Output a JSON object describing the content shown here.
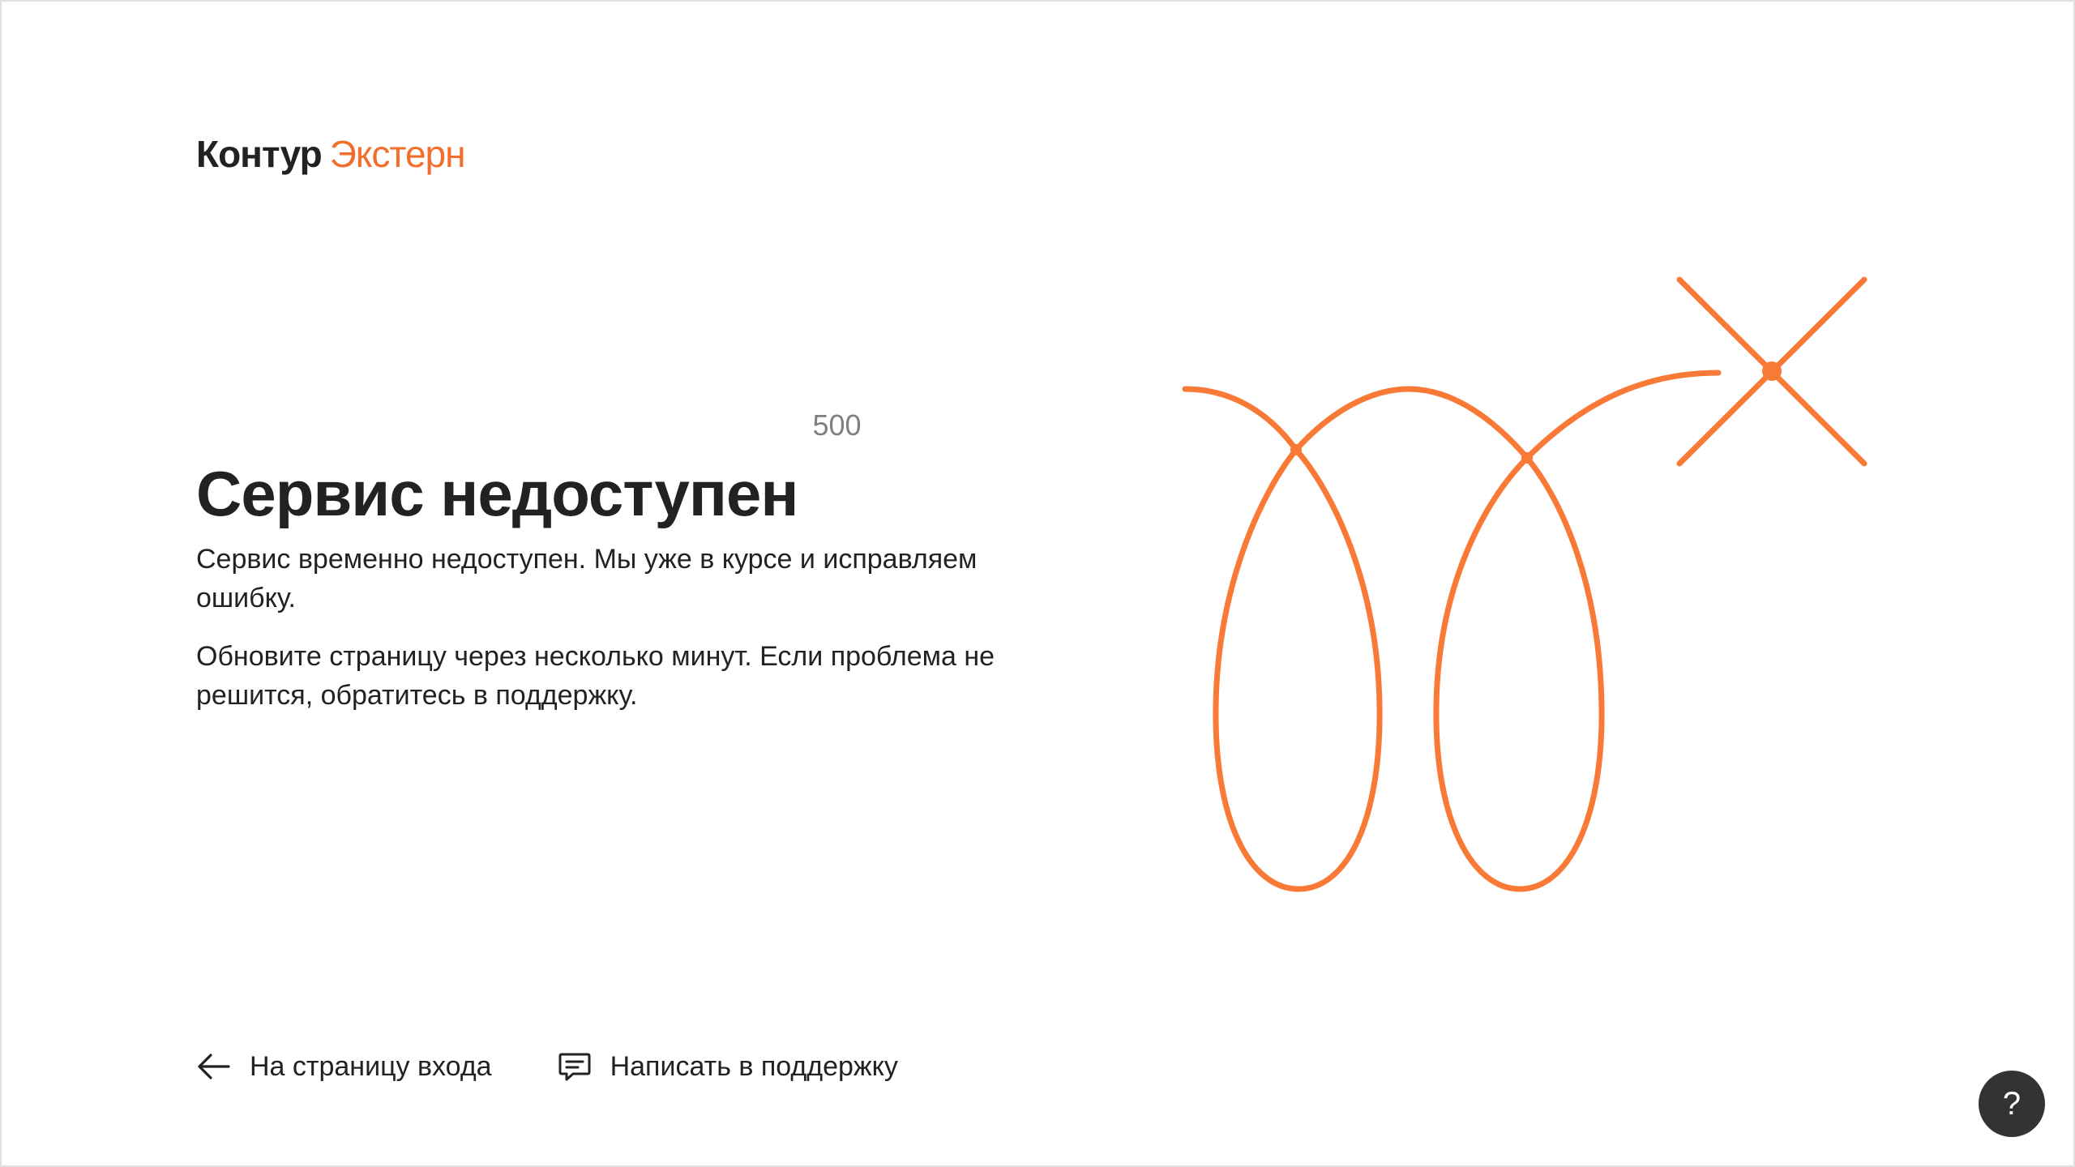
{
  "brand": {
    "name": "Контур",
    "product": "Экстерн",
    "accent_color": "#f26e2c"
  },
  "error": {
    "title": "Сервис недоступен",
    "code": "500",
    "paragraphs": [
      "Сервис временно недоступен. Мы уже в курсе и исправляем ошибку.",
      "Обновите страницу через несколько минут. Если проблема не решится, обратитесь в поддержку."
    ]
  },
  "actions": {
    "login": {
      "label": "На страницу входа",
      "icon": "arrow-left-icon"
    },
    "support": {
      "label": "Написать в поддержку",
      "icon": "chat-bubble-icon"
    }
  },
  "illustration": {
    "name": "looped-line-with-cross",
    "color": "#f26e2c"
  },
  "help_button": {
    "label": "?",
    "icon": "help-icon"
  }
}
